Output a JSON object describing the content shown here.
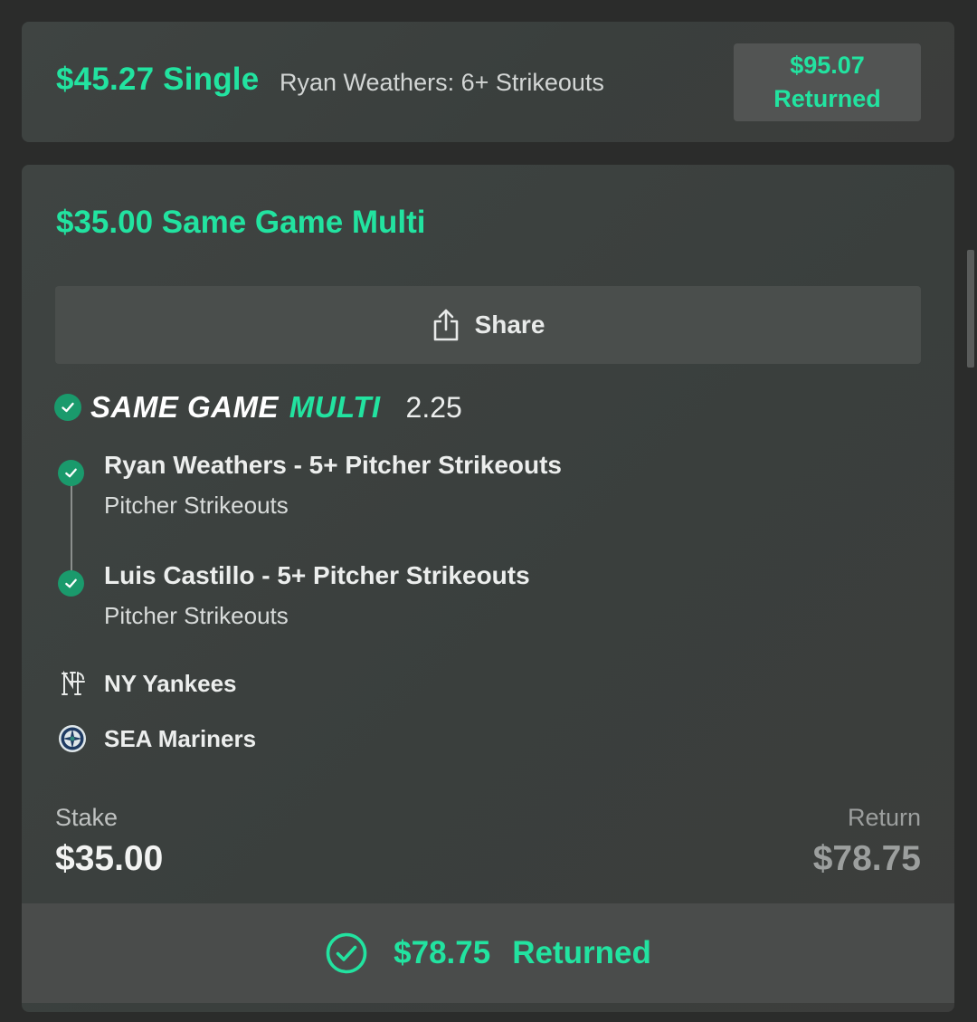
{
  "single_bet": {
    "amount_label": "$45.27 Single",
    "selection": "Ryan Weathers: 6+ Strikeouts",
    "returned_amount": "$95.07",
    "returned_label": "Returned"
  },
  "multi_bet": {
    "title": "$35.00 Same Game Multi",
    "share_label": "Share",
    "sgm_logo_part1": "SAME GAME",
    "sgm_logo_part2": "MULTI",
    "odds": "2.25",
    "legs": [
      {
        "title": "Ryan Weathers - 5+ Pitcher Strikeouts",
        "market": "Pitcher Strikeouts",
        "status": "won"
      },
      {
        "title": "Luis Castillo - 5+ Pitcher Strikeouts",
        "market": "Pitcher Strikeouts",
        "status": "won"
      }
    ],
    "teams": [
      {
        "name": "NY Yankees",
        "icon": "yankees-logo-icon"
      },
      {
        "name": "SEA Mariners",
        "icon": "mariners-logo-icon"
      }
    ],
    "stake_label": "Stake",
    "stake_value": "$35.00",
    "return_label": "Return",
    "return_value": "$78.75",
    "result_amount": "$78.75",
    "result_label": "Returned"
  },
  "colors": {
    "accent": "#22e3a0",
    "check_bg": "#1a9a6c",
    "background": "#2b2c2b"
  }
}
